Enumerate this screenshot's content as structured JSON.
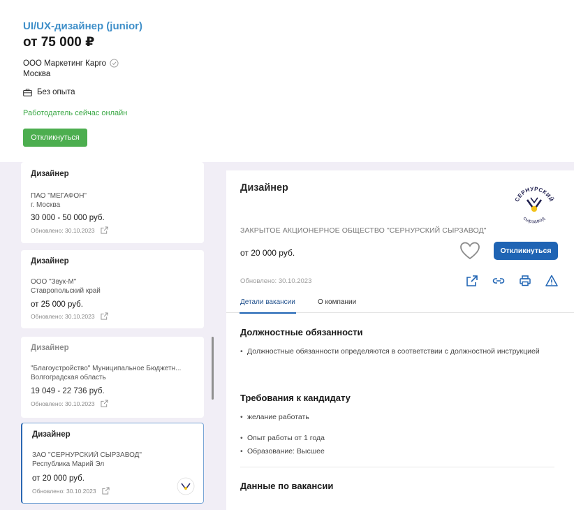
{
  "top": {
    "job_title": "UI/UX-дизайнер (junior)",
    "salary": "от 75 000 ₽",
    "company": "ООО Маркетинг Карго",
    "city": "Москва",
    "experience": "Без опыта",
    "online_status": "Работодатель сейчас онлайн",
    "respond_label": "Откликнуться",
    "accent_color": "#3f8fc9",
    "online_color": "#3aa845"
  },
  "list": {
    "cards": [
      {
        "title": "Дизайнер",
        "company": "ПАО \"МЕГАФОН\"",
        "region": "г. Москва",
        "salary": "30 000 - 50 000 руб.",
        "updated": "Обновлено: 30.10.2023"
      },
      {
        "title": "Дизайнер",
        "company": "ООО \"Звук-М\"",
        "region": "Ставропольский край",
        "salary": "от 25 000 руб.",
        "updated": "Обновлено: 30.10.2023"
      },
      {
        "title": "Дизайнер",
        "company": "\"Благоустройство\" Муниципальное Бюджетн...",
        "region": "Волгоградская область",
        "salary": "19 049 - 22 736 руб.",
        "updated": "Обновлено: 30.10.2023"
      },
      {
        "title": "Дизайнер",
        "company": "ЗАО \"СЕРНУРСКИЙ СЫРЗАВОД\"",
        "region": "Республика Марий Эл",
        "salary": "от 20 000 руб.",
        "updated": "Обновлено: 30.10.2023"
      }
    ]
  },
  "detail": {
    "title": "Дизайнер",
    "logo_text_top": "СЕРНУРСКИЙ",
    "logo_text_bottom": "сырзавод",
    "org": "ЗАКРЫТОЕ АКЦИОНЕРНОЕ ОБЩЕСТВО \"СЕРНУРСКИЙ СЫРЗАВОД\"",
    "salary": "от 20 000 руб.",
    "respond_label": "Откликнуться",
    "updated": "Обновлено: 30.10.2023",
    "tabs": [
      "Детали вакансии",
      "О компании"
    ],
    "duties_heading": "Должностные обязанности",
    "duties": [
      "Должностные обязанности определяются в соответствии с должностной инструкцией"
    ],
    "requirements_heading": "Требования к кандидату",
    "requirements": [
      "желание работать",
      "Опыт работы от 1 года",
      "Образование: Высшее"
    ],
    "vacancy_data_heading": "Данные по вакансии",
    "primary_color": "#1f64b4"
  }
}
